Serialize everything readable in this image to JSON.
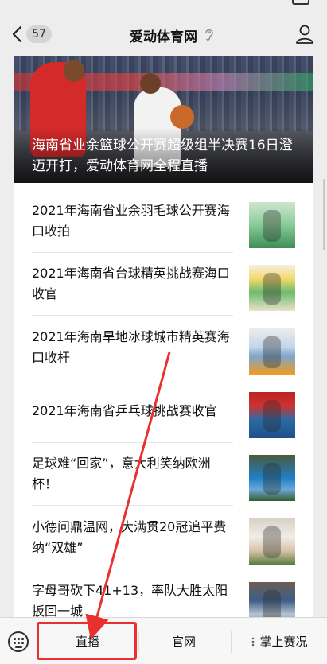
{
  "navbar": {
    "badge": "57",
    "title": "爱动体育网"
  },
  "hero": {
    "title": "海南省业余篮球公开赛超级组半决赛16日澄迈开打，爱动体育网全程直播"
  },
  "articles": [
    {
      "title": "2021年海南省业余羽毛球公开赛海口收拍"
    },
    {
      "title": "2021年海南省台球精英挑战赛海口收官"
    },
    {
      "title": "2021年海南旱地冰球城市精英赛海口收杆"
    },
    {
      "title": "2021年海南省乒乓球挑战赛收官"
    },
    {
      "title": "足球难“回家”，意大利笑纳欧洲杯！"
    },
    {
      "title": "小德问鼎温网，大满贯20冠追平费纳“双雄”"
    },
    {
      "title": "字母哥砍下41+13，率队大胜太阳扳回一城"
    }
  ],
  "tabbar": {
    "tab1": "直播",
    "tab2": "官网",
    "tab3": "掌上赛况"
  },
  "annotation_color": "#e8302f"
}
